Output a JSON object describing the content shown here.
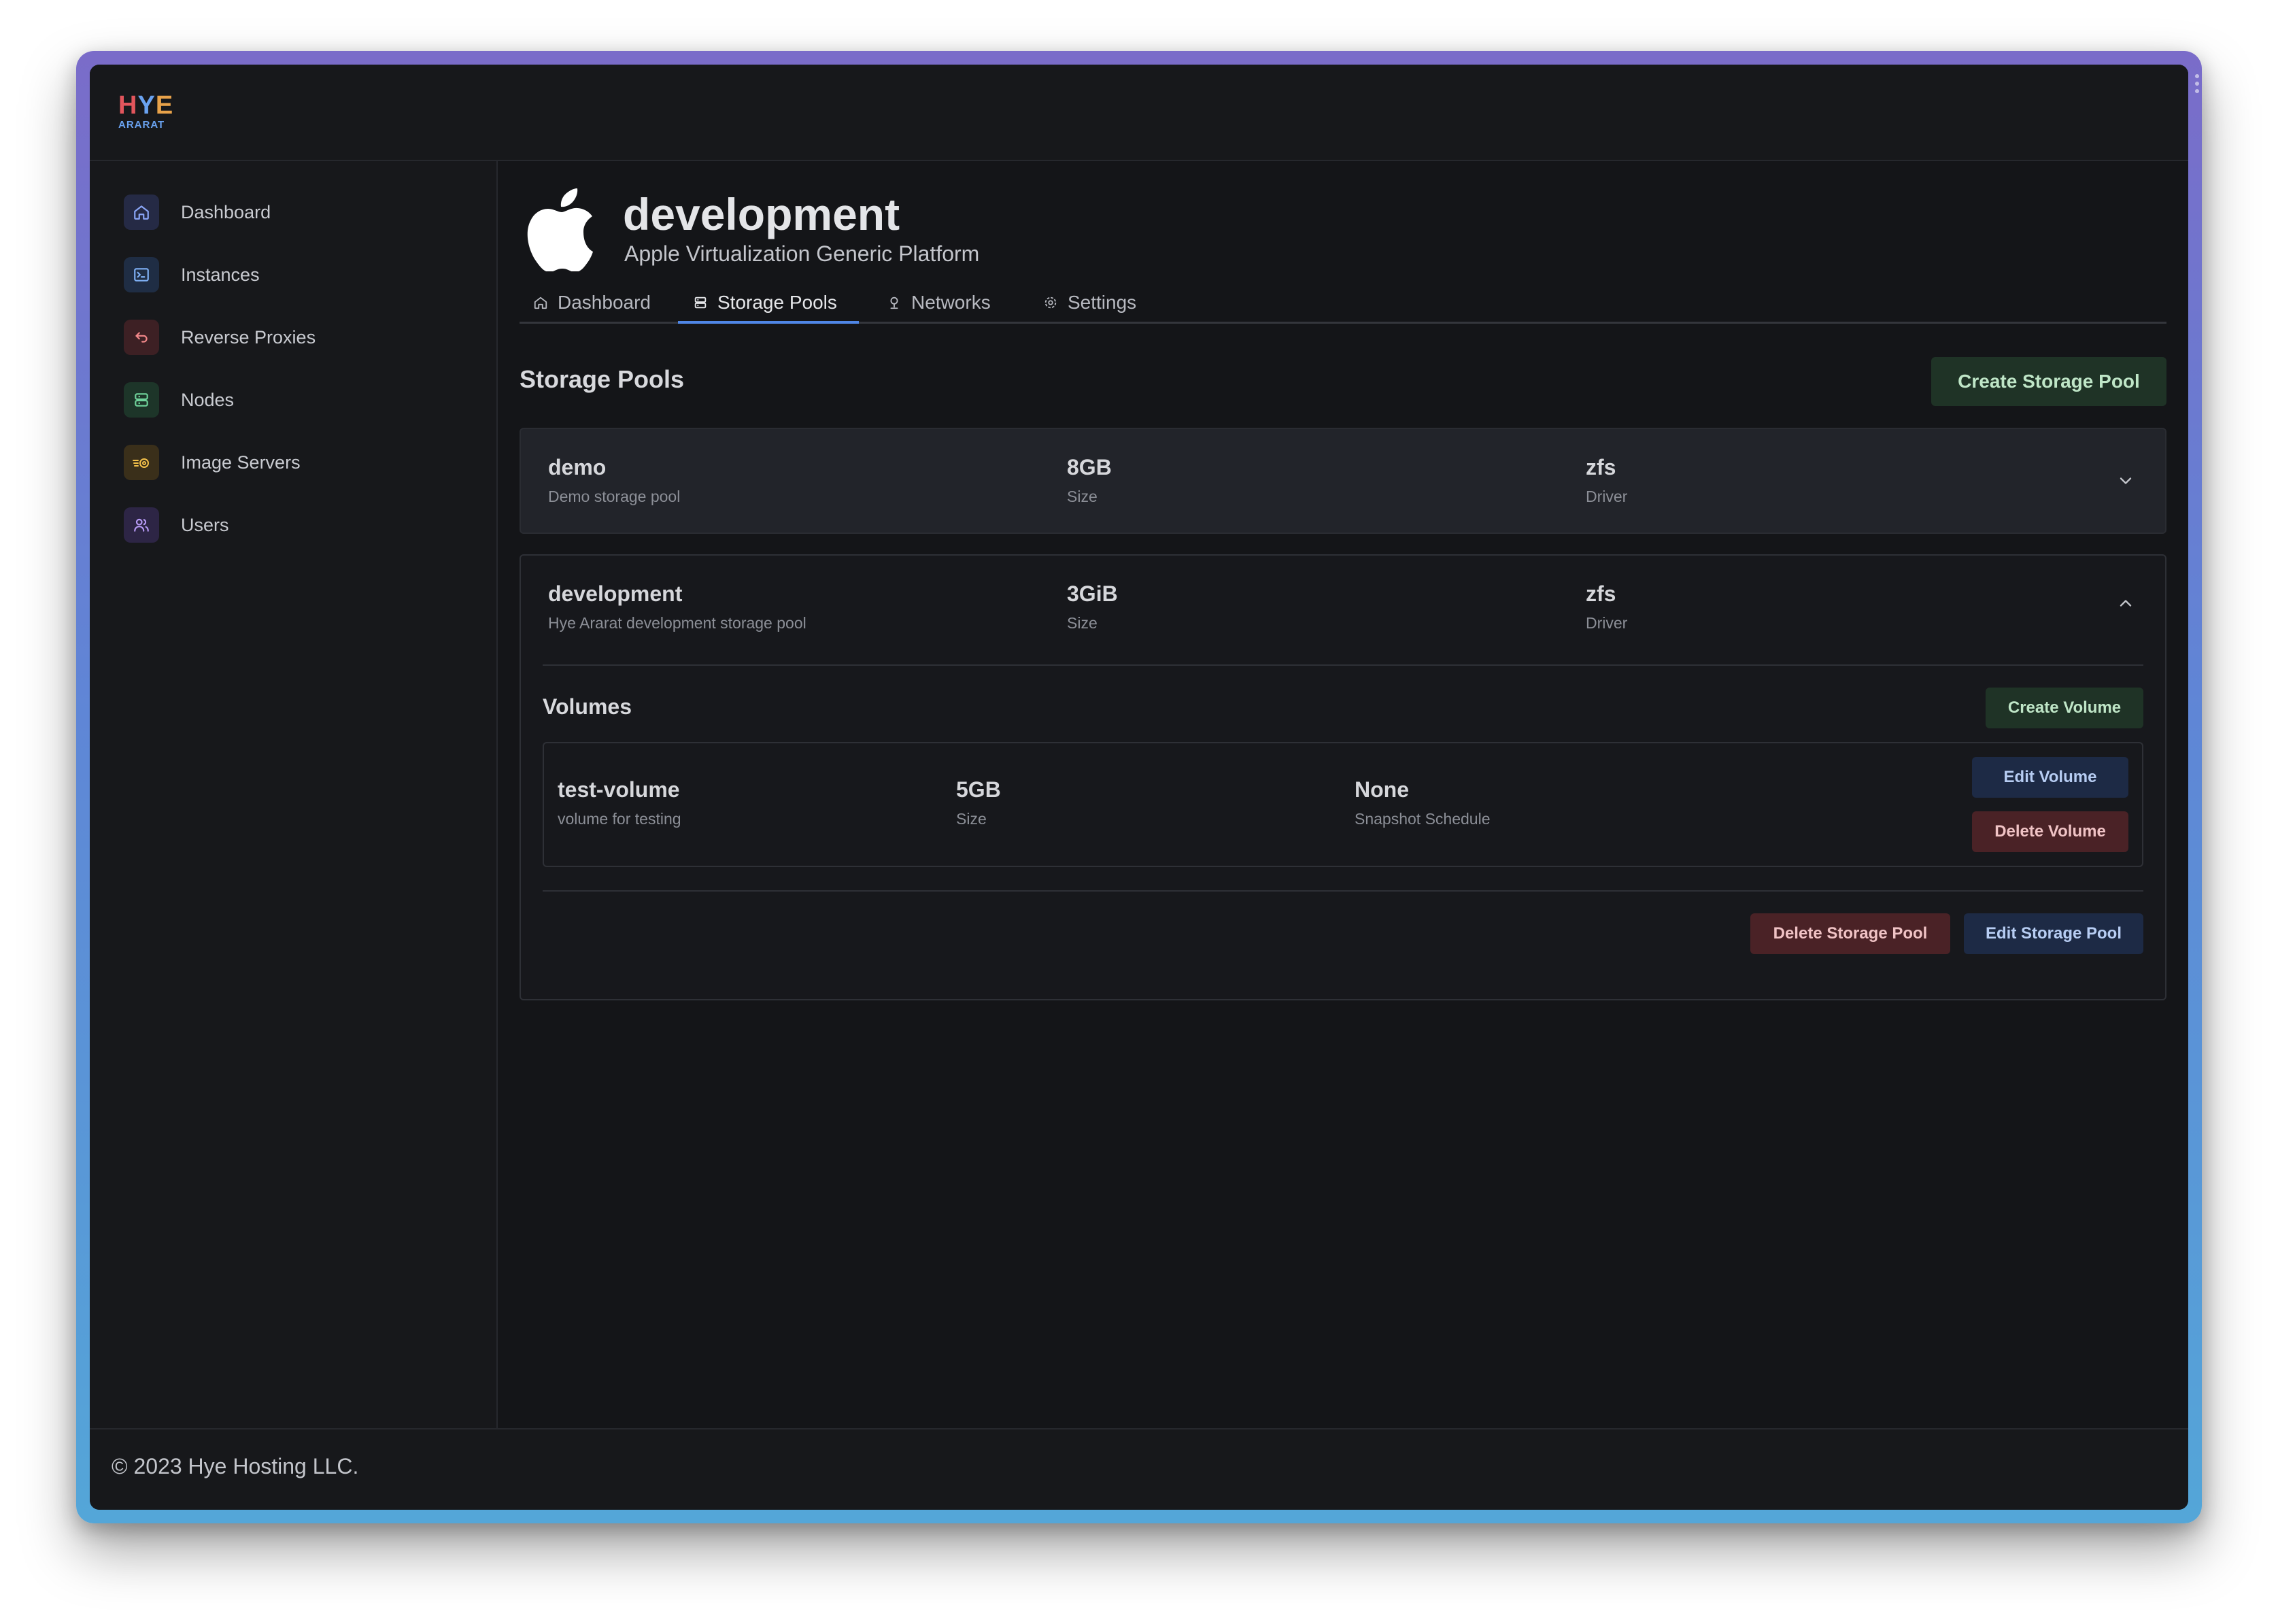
{
  "app": {
    "logo_main": "HYE",
    "logo_sub": "ARARAT"
  },
  "sidebar": {
    "items": [
      {
        "label": "Dashboard",
        "icon": "home-icon",
        "color": "#7f9cf5"
      },
      {
        "label": "Instances",
        "icon": "terminal-icon",
        "color": "#7fb0f5"
      },
      {
        "label": "Reverse Proxies",
        "icon": "return-arrow-icon",
        "color": "#f07f7f"
      },
      {
        "label": "Nodes",
        "icon": "server-icon",
        "color": "#6fd39b"
      },
      {
        "label": "Image Servers",
        "icon": "image-server-icon",
        "color": "#f3c04a"
      },
      {
        "label": "Users",
        "icon": "users-icon",
        "color": "#b79af5"
      }
    ]
  },
  "header": {
    "title": "development",
    "subtitle": "Apple Virtualization Generic Platform",
    "platform_icon": "apple-icon"
  },
  "tabs": [
    {
      "label": "Dashboard",
      "icon": "home-icon",
      "active": false
    },
    {
      "label": "Storage Pools",
      "icon": "storage-icon",
      "active": true
    },
    {
      "label": "Networks",
      "icon": "network-icon",
      "active": false
    },
    {
      "label": "Settings",
      "icon": "gear-icon",
      "active": false
    }
  ],
  "storage": {
    "section_title": "Storage Pools",
    "create_label": "Create Storage Pool",
    "pools": [
      {
        "name": "demo",
        "description": "Demo storage pool",
        "size": "8GB",
        "size_label": "Size",
        "driver": "zfs",
        "driver_label": "Driver",
        "expanded": false
      },
      {
        "name": "development",
        "description": "Hye Ararat development storage pool",
        "size": "3GiB",
        "size_label": "Size",
        "driver": "zfs",
        "driver_label": "Driver",
        "expanded": true,
        "volumes_title": "Volumes",
        "create_volume_label": "Create Volume",
        "volumes": [
          {
            "name": "test-volume",
            "description": "volume for testing",
            "size": "5GB",
            "size_label": "Size",
            "schedule": "None",
            "schedule_label": "Snapshot Schedule",
            "edit_label": "Edit Volume",
            "delete_label": "Delete Volume"
          }
        ],
        "delete_pool_label": "Delete Storage Pool",
        "edit_pool_label": "Edit Storage Pool"
      }
    ]
  },
  "footer": {
    "text": "© 2023 Hye Hosting LLC."
  }
}
